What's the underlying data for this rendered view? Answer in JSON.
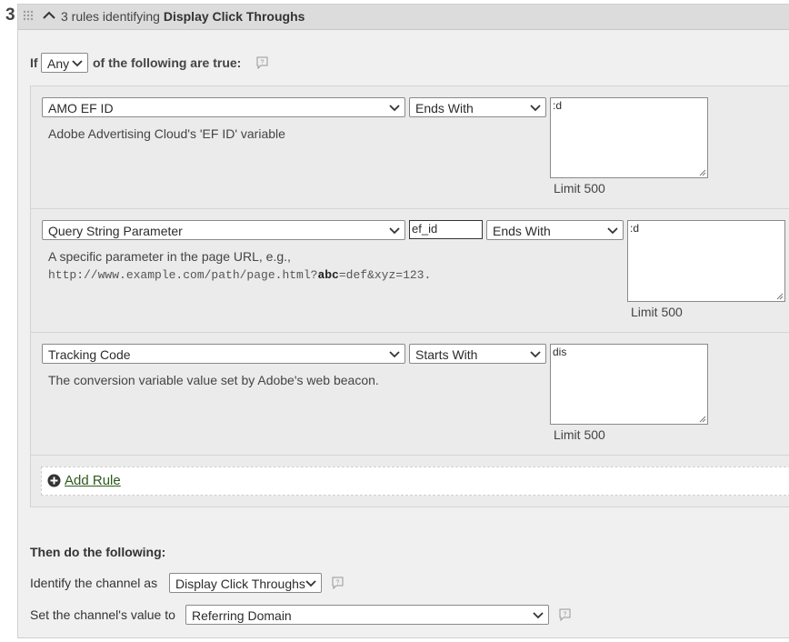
{
  "rule_number": "3",
  "header": {
    "count_text": "3 rules identifying",
    "channel_name": "Display Click Throughs",
    "grip_icon": "grip-dots-icon",
    "collapse_icon": "chevron-up-icon"
  },
  "condition": {
    "prefix": "If",
    "match_value": "Any",
    "suffix": "of the following are true:"
  },
  "rules": [
    {
      "variable": "AMO EF ID",
      "operator": "Ends With",
      "value": ":d",
      "description": "Adobe Advertising Cloud's 'EF ID' variable",
      "limit": "Limit 500"
    },
    {
      "variable": "Query String Parameter",
      "param": "ef_id",
      "operator": "Ends With",
      "value": ":d",
      "description": "A specific parameter in the page URL, e.g.,",
      "example_prefix": "http://www.example.com/path/page.html?",
      "example_param": "abc",
      "example_suffix": "=def&xyz=123.",
      "limit": "Limit 500"
    },
    {
      "variable": "Tracking Code",
      "operator": "Starts With",
      "value": "dis",
      "description": "The conversion variable value set by Adobe's web beacon.",
      "limit": "Limit 500"
    }
  ],
  "add_rule": {
    "label": "Add Rule",
    "icon": "plus-circle-icon"
  },
  "then": {
    "title": "Then do the following:",
    "identify_label": "Identify the channel as",
    "identify_value": "Display Click Throughs",
    "set_label": "Set the channel's value to",
    "set_value": "Referring Domain"
  }
}
